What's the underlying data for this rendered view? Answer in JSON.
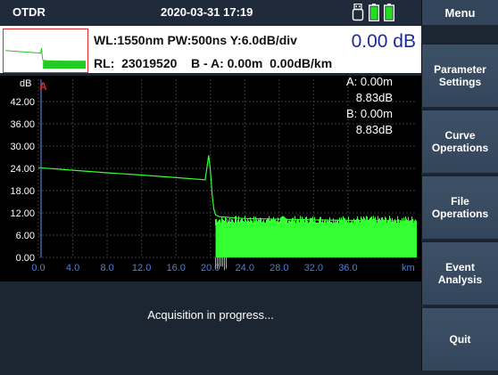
{
  "header": {
    "app_title": "OTDR",
    "datetime": "2020-03-31 17:19",
    "icons": [
      "usb-icon",
      "battery-icon",
      "battery-icon"
    ]
  },
  "menu": {
    "title": "Menu",
    "items": [
      {
        "label": "Parameter\nSettings"
      },
      {
        "label": "Curve\nOperations"
      },
      {
        "label": "File\nOperations"
      },
      {
        "label": "Event\nAnalysis"
      },
      {
        "label": "Quit"
      }
    ]
  },
  "info": {
    "line1": "WL:1550nm PW:500ns Y:6.0dB/div",
    "line2": "RL:  23019520    B - A: 0.00m  0.00dB/km",
    "big_value": "0.00 dB"
  },
  "cursor": {
    "a_marker": "A",
    "a_dist": "A: 0.00m",
    "a_db": "8.83dB",
    "b_dist": "B: 0.00m",
    "b_db": "8.83dB"
  },
  "status": {
    "text": "Acquisition in progress..."
  },
  "colors": {
    "trace": "#33ff33",
    "axis_x_labels": "#4f7fd6",
    "axis_y_labels": "#ffffff",
    "cursor_a": "#e02828"
  },
  "chart_data": {
    "type": "line",
    "ylabel": "dB",
    "xlabel": "km",
    "xlim": [
      0,
      44
    ],
    "ylim": [
      0,
      48
    ],
    "x_ticks": [
      "0.0",
      "4.0",
      "8.0",
      "12.0",
      "16.0",
      "20.0",
      "24.0",
      "28.0",
      "32.0",
      "36.0"
    ],
    "y_ticks": [
      "0.00",
      "6.00",
      "12.00",
      "18.00",
      "24.00",
      "30.00",
      "36.00",
      "42.00"
    ],
    "grid": true,
    "series": [
      {
        "x": [
          0,
          4,
          8,
          12,
          16,
          19.4,
          19.8,
          20.0,
          20.2,
          20.4,
          20.6,
          21,
          22,
          23,
          24,
          26,
          28,
          30,
          32,
          36,
          40,
          44
        ],
        "y": [
          24.2,
          23.5,
          22.8,
          22.2,
          21.5,
          20.9,
          27.5,
          23.5,
          17,
          13,
          11.5,
          11,
          10.8,
          10.6,
          10.5,
          10.4,
          10.3,
          10.2,
          10.1,
          10.0,
          9.9,
          9.8
        ]
      }
    ],
    "noise_floor": {
      "x_start": 20.6,
      "x_end": 44,
      "top": 10.5,
      "bottom": 0
    }
  }
}
